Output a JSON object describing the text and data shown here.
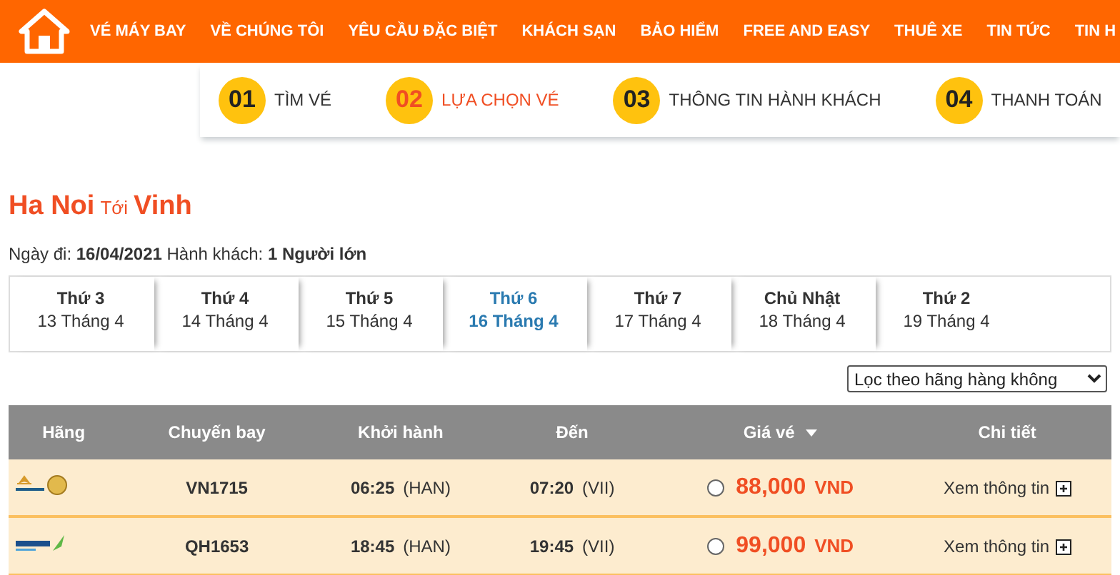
{
  "nav": {
    "items": [
      "VÉ MÁY BAY",
      "VỀ CHÚNG TÔI",
      "YÊU CẦU ĐẶC BIỆT",
      "KHÁCH SẠN",
      "BẢO HIỂM",
      "FREE AND EASY",
      "THUÊ XE",
      "TIN TỨC",
      "TIN H"
    ]
  },
  "steps": [
    {
      "number": "01",
      "label": "TÌM VÉ",
      "selected": false
    },
    {
      "number": "02",
      "label": "LỰA CHỌN VÉ",
      "selected": true
    },
    {
      "number": "03",
      "label": "THÔNG TIN HÀNH KHÁCH",
      "selected": false
    },
    {
      "number": "04",
      "label": "THANH TOÁN",
      "selected": false
    }
  ],
  "route": {
    "from": "Ha Noi",
    "joiner": "Tới",
    "to": "Vinh"
  },
  "trip_info": "Ngày đi: **16/04/2021** Hành khách: **1 Người lớn**",
  "dates": [
    {
      "day": "Thứ 3",
      "date": "13 Tháng 4",
      "selected": false
    },
    {
      "day": "Thứ 4",
      "date": "14 Tháng 4",
      "selected": false
    },
    {
      "day": "Thứ 5",
      "date": "15 Tháng 4",
      "selected": false
    },
    {
      "day": "Thứ 6",
      "date": "16 Tháng 4",
      "selected": true
    },
    {
      "day": "Thứ 7",
      "date": "17 Tháng 4",
      "selected": false
    },
    {
      "day": "Chủ Nhật",
      "date": "18 Tháng 4",
      "selected": false
    },
    {
      "day": "Thứ 2",
      "date": "19 Tháng 4",
      "selected": false
    }
  ],
  "filter": {
    "value": "Lọc theo hãng hàng không"
  },
  "table": {
    "columns": [
      "Hãng",
      "Chuyến bay",
      "Khởi hành",
      "Đến",
      "Giá vé",
      "Chi tiết"
    ],
    "rows": [
      {
        "kind": "vietnam",
        "flight": "VN1715",
        "depart_time": "06:25",
        "depart_code": "(HAN)",
        "arrive_time": "07:20",
        "arrive_code": "(VII)",
        "price": "88,000",
        "currency": "VND",
        "detail": "Xem thông tin",
        "selected": false
      },
      {
        "kind": "bamboo",
        "flight": "QH1653",
        "depart_time": "18:45",
        "depart_code": "(HAN)",
        "arrive_time": "19:45",
        "arrive_code": "(VII)",
        "price": "99,000",
        "currency": "VND",
        "detail": "Xem thông tin",
        "selected": false
      }
    ]
  }
}
